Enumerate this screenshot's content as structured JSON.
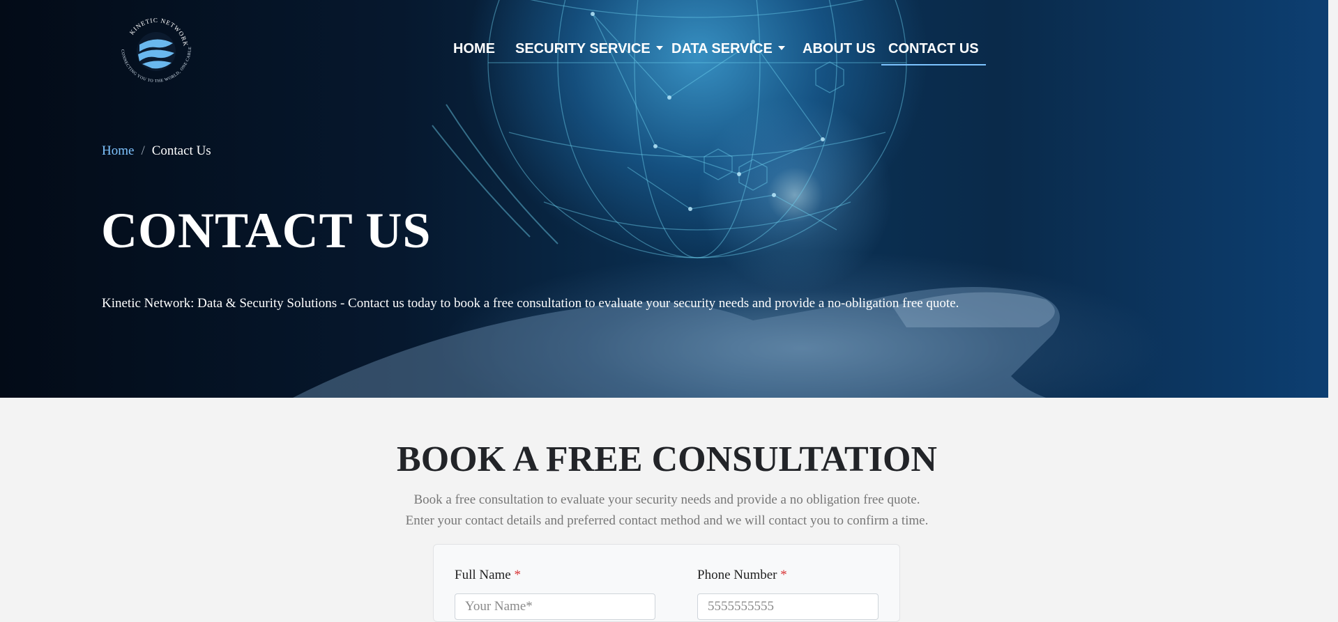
{
  "brand": {
    "name": "KINETIC NETWORK",
    "tagline": "CONNECTING YOU TO THE WORLD, ONE CABLE AT A TIME"
  },
  "nav": {
    "home": "HOME",
    "security": "SECURITY SERVICE",
    "data": "DATA SERVICE",
    "about": "ABOUT US",
    "contact": "CONTACT US"
  },
  "breadcrumb": {
    "home": "Home",
    "separator": "/",
    "current": "Contact Us"
  },
  "hero": {
    "title": "CONTACT US",
    "description": "Kinetic Network: Data & Security Solutions - Contact us today to book a free consultation to evaluate your security needs and provide a no-obligation free quote."
  },
  "consultation": {
    "title": "BOOK A FREE CONSULTATION",
    "line1": "Book a free consultation to evaluate your security needs and provide a no obligation free quote.",
    "line2": "Enter your contact details and preferred contact method and we will contact you to confirm a time."
  },
  "form": {
    "full_name_label": "Full Name",
    "full_name_placeholder": "Your Name*",
    "phone_label": "Phone Number",
    "phone_placeholder": "5555555555",
    "required_mark": "*"
  },
  "colors": {
    "accent": "#7fc4ff",
    "required": "#d9383a",
    "heading": "#222428"
  }
}
